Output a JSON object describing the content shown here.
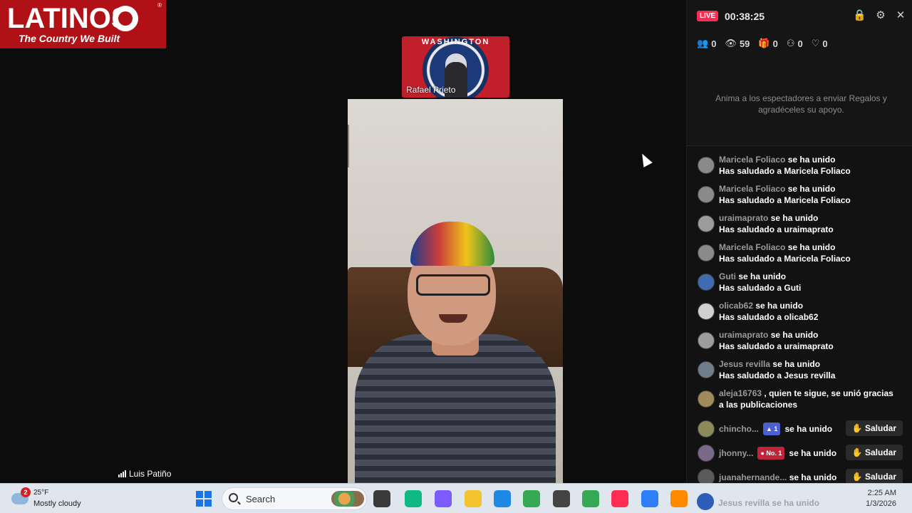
{
  "logo": {
    "text_big": "LATINOS",
    "text_small": "The Country We Built",
    "registered": "®"
  },
  "guest": {
    "banner_text": "WASHINGTON",
    "name": "Rafael Prieto"
  },
  "host": {
    "name": "Luis Patiño"
  },
  "live_panel": {
    "live_label": "LIVE",
    "timer": "00:38:25",
    "stats": [
      {
        "icon": "people-icon",
        "glyph": "👥",
        "value": "0"
      },
      {
        "icon": "eye-icon",
        "glyph": "👁",
        "value": "59"
      },
      {
        "icon": "gift-icon",
        "glyph": "🎁",
        "value": "0"
      },
      {
        "icon": "share-icon",
        "glyph": "⚇",
        "value": "0"
      },
      {
        "icon": "heart-icon",
        "glyph": "♡",
        "value": "0"
      }
    ],
    "hint": "Anima a los espectadores a enviar Regalos y agradéceles su apoyo."
  },
  "chat": [
    {
      "user": "Maricela Foliaco",
      "action": "se ha unido",
      "line2": "Has saludado a Maricela Foliaco",
      "avatar_color": "#8a8a8a"
    },
    {
      "user": "Maricela Foliaco",
      "action": "se ha unido",
      "line2": "Has saludado a Maricela Foliaco",
      "avatar_color": "#8a8a8a"
    },
    {
      "user": "uraimaprato",
      "action": "se ha unido",
      "line2": "Has saludado a uraimaprato",
      "avatar_color": "#9c9c9c"
    },
    {
      "user": "Maricela Foliaco",
      "action": "se ha unido",
      "line2": "Has saludado a Maricela Foliaco",
      "avatar_color": "#8a8a8a"
    },
    {
      "user": "Guti",
      "action": "se ha unido",
      "line2": "Has saludado a Guti",
      "avatar_color": "#3f6bb0"
    },
    {
      "user": "olicab62",
      "action": "se ha unido",
      "line2": "Has saludado a olicab62",
      "avatar_color": "#d0d0d0"
    },
    {
      "user": "uraimaprato",
      "action": "se ha unido",
      "line2": "Has saludado a uraimaprato",
      "avatar_color": "#9c9c9c"
    },
    {
      "user": "Jesus revilla",
      "action": "se ha unido",
      "line2": "Has saludado a Jesus revilla",
      "avatar_color": "#6f7d8c"
    },
    {
      "user": "aleja16763",
      "action": ", quien te sigue, se unió gracias",
      "line2": "a las publicaciones",
      "avatar_color": "#a38a5a"
    }
  ],
  "chat_rows": [
    {
      "user": "chincho...",
      "badge": "▲ 1",
      "badge_color": "#4a5fd1",
      "action": "se ha unido",
      "button": "Saludar",
      "avatar_color": "#8c8a5a"
    },
    {
      "user": "jhonny...",
      "badge": "● No. 1",
      "badge_color": "#c0243a",
      "action": "se ha unido",
      "button": "Saludar",
      "avatar_color": "#7a6a8a"
    },
    {
      "user": "juanahernande...",
      "badge": "",
      "badge_color": "",
      "action": "se ha unido",
      "button": "Saludar",
      "avatar_color": "#5a5a5a"
    }
  ],
  "ghost_row": {
    "user": "Jesus revilla",
    "action": "se ha unido"
  },
  "taskbar": {
    "notification_count": "2",
    "temperature": "25°F",
    "condition": "Mostly cloudy",
    "search_placeholder": "Search",
    "time": "2:25 AM",
    "date": "1/3/2026",
    "apps": [
      {
        "name": "task-view-icon",
        "color": "#3a3a3a"
      },
      {
        "name": "copilot-app-icon",
        "color": "#10b981"
      },
      {
        "name": "copilot-icon",
        "color": "#7c5cff"
      },
      {
        "name": "file-explorer-icon",
        "color": "#f4c430"
      },
      {
        "name": "edge-icon",
        "color": "#1e88e5"
      },
      {
        "name": "chrome-icon",
        "color": "#34a853"
      },
      {
        "name": "chrome-dark-icon",
        "color": "#444444"
      },
      {
        "name": "chrome-2-icon",
        "color": "#34a853"
      },
      {
        "name": "tiktok-icon",
        "color": "#fe2c55"
      },
      {
        "name": "notepad-icon",
        "color": "#2d7ff9"
      },
      {
        "name": "firefox-icon",
        "color": "#ff8a00"
      }
    ]
  }
}
